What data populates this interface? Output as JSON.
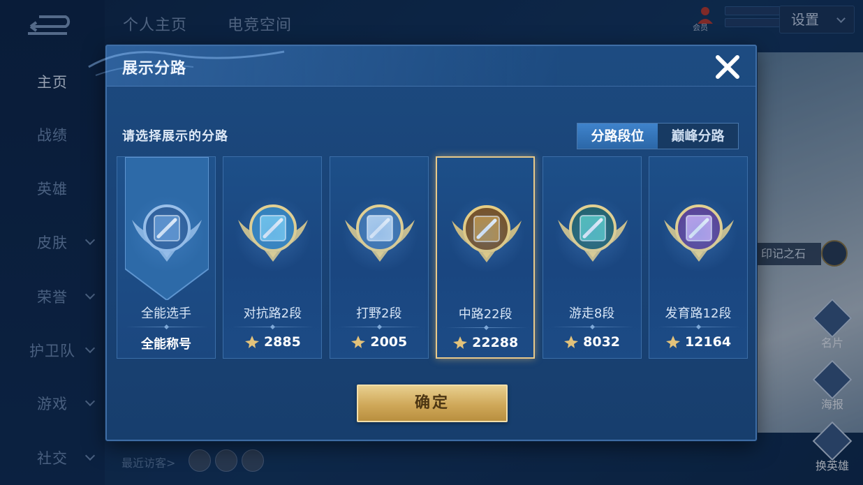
{
  "nav": {
    "items": [
      {
        "label": "主页",
        "active": true,
        "has_chevron": false
      },
      {
        "label": "战绩",
        "active": false,
        "has_chevron": false
      },
      {
        "label": "英雄",
        "active": false,
        "has_chevron": false
      },
      {
        "label": "皮肤",
        "active": false,
        "has_chevron": true
      },
      {
        "label": "荣誉",
        "active": false,
        "has_chevron": true
      },
      {
        "label": "护卫队",
        "active": false,
        "has_chevron": true
      },
      {
        "label": "游戏",
        "active": false,
        "has_chevron": true
      },
      {
        "label": "社交",
        "active": false,
        "has_chevron": true
      }
    ]
  },
  "top_tabs": [
    "个人主页",
    "电竞空间"
  ],
  "top_right": {
    "member_label": "会员",
    "settings_label": "设置"
  },
  "right_panel": {
    "stone_label": "印记之石",
    "card_label": "名片",
    "poster_label": "海报",
    "change_hero_label": "换英雄"
  },
  "bottom": {
    "recent_visitors_label": "最近访客>"
  },
  "modal": {
    "title": "展示分路",
    "subtitle": "请选择展示的分路",
    "toggle": {
      "options": [
        "分路段位",
        "巅峰分路"
      ],
      "active_index": 0
    },
    "cards": [
      {
        "label": "全能选手",
        "value": "全能称号",
        "badge": "all-round-badge-icon",
        "selected": false,
        "ribbon": true
      },
      {
        "label": "对抗路2段",
        "value": "2885",
        "badge": "clash-lane-badge-icon",
        "selected": false,
        "ribbon": false
      },
      {
        "label": "打野2段",
        "value": "2005",
        "badge": "jungle-badge-icon",
        "selected": false,
        "ribbon": false
      },
      {
        "label": "中路22段",
        "value": "22288",
        "badge": "mid-lane-badge-icon",
        "selected": true,
        "ribbon": false
      },
      {
        "label": "游走8段",
        "value": "8032",
        "badge": "roam-badge-icon",
        "selected": false,
        "ribbon": false
      },
      {
        "label": "发育路12段",
        "value": "12164",
        "badge": "farm-lane-badge-icon",
        "selected": false,
        "ribbon": false
      }
    ],
    "confirm_label": "确定"
  },
  "colors": {
    "modal_bg": "#1a4478",
    "selected_border": "#e8c98a",
    "toggle_active": "#3f83cc",
    "confirm_gold": "#cfa859"
  }
}
